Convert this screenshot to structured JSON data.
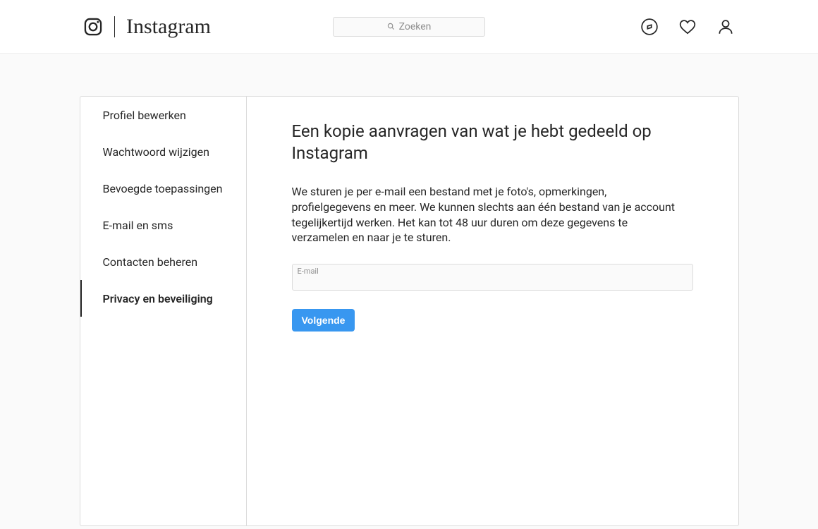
{
  "header": {
    "brand_word": "Instagram",
    "search_placeholder": "Zoeken"
  },
  "sidebar": {
    "items": [
      {
        "label": "Profiel bewerken",
        "active": false
      },
      {
        "label": "Wachtwoord wijzigen",
        "active": false
      },
      {
        "label": "Bevoegde toepassingen",
        "active": false
      },
      {
        "label": "E-mail en sms",
        "active": false
      },
      {
        "label": "Contacten beheren",
        "active": false
      },
      {
        "label": "Privacy en beveiliging",
        "active": true
      }
    ]
  },
  "main": {
    "title": "Een kopie aanvragen van wat je hebt gedeeld op Instagram",
    "description": "We sturen je per e-mail een bestand met je foto's, opmerkingen, profielgegevens en meer. We kunnen slechts aan één bestand van je account tegelijkertijd werken. Het kan tot 48 uur duren om deze gegevens te verzamelen en naar je te sturen.",
    "email_label": "E-mail",
    "email_value": "",
    "submit_label": "Volgende"
  }
}
